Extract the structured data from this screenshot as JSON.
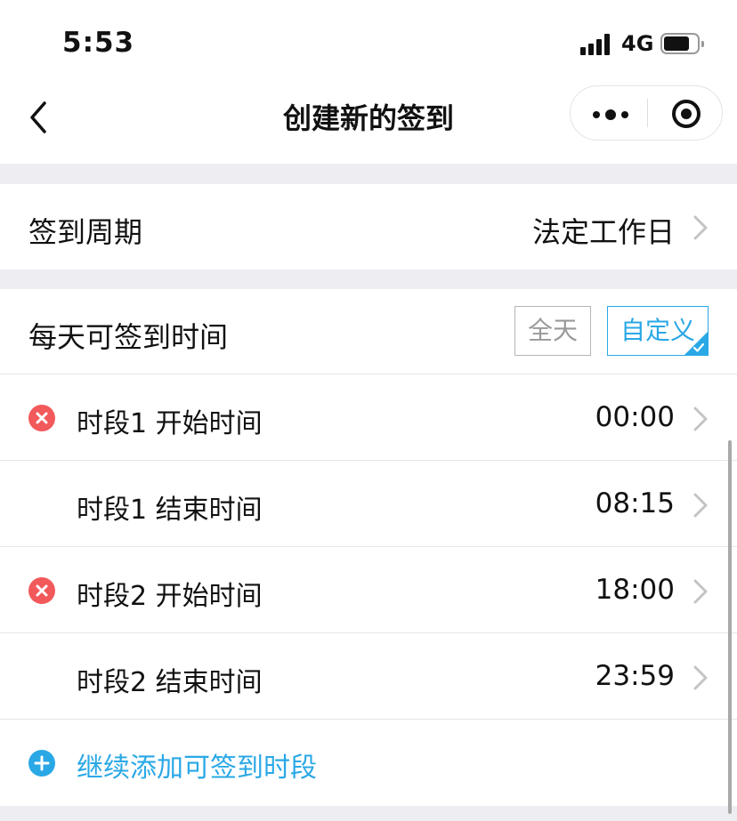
{
  "status_bar": {
    "time": "5:53",
    "network": "4G"
  },
  "nav": {
    "title": "创建新的签到"
  },
  "period": {
    "label": "签到周期",
    "value": "法定工作日"
  },
  "daily_time": {
    "label": "每天可签到时间",
    "options": [
      "全天",
      "自定义"
    ],
    "selected": "自定义"
  },
  "slots": [
    {
      "label": "时段1 开始时间",
      "value": "00:00",
      "removable": true
    },
    {
      "label": "时段1 结束时间",
      "value": "08:15",
      "removable": false
    },
    {
      "label": "时段2 开始时间",
      "value": "18:00",
      "removable": true
    },
    {
      "label": "时段2 结束时间",
      "value": "23:59",
      "removable": false
    }
  ],
  "add_slot": {
    "label": "继续添加可签到时段"
  },
  "colors": {
    "accent": "#2aa8e6",
    "danger": "#f2595b",
    "background": "#ededf2"
  }
}
